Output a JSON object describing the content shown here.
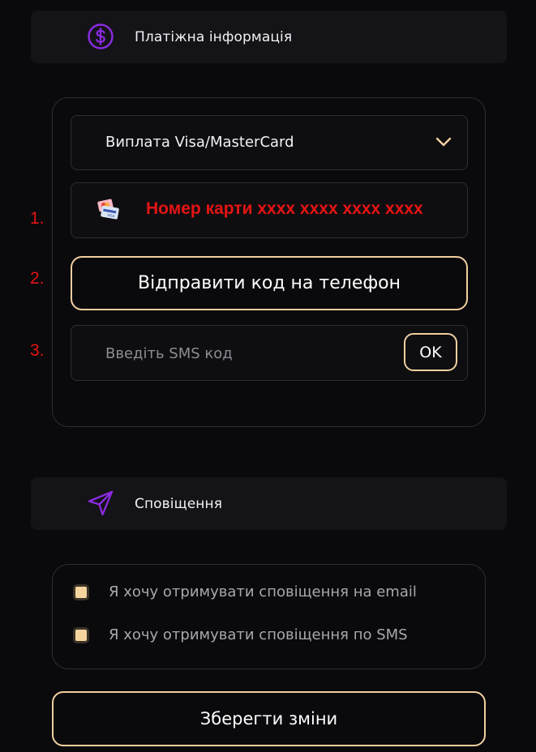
{
  "payment_section": {
    "title": "Платіжна інформація",
    "icon": "dollar-icon"
  },
  "payment": {
    "method_selected": "Виплата Visa/MasterCard",
    "card_number_text": "Номер карти xxxx xxxx xxxx xxxx",
    "send_code_label": "Відправити код на телефон",
    "sms_placeholder": "Введіть SMS код",
    "ok_label": "OK"
  },
  "steps": [
    "1.",
    "2.",
    "3."
  ],
  "notifications_section": {
    "title": "Сповіщення",
    "icon": "send-icon"
  },
  "notifications": {
    "email_label": "Я хочу отримувати сповіщення на email",
    "email_checked": true,
    "sms_label": "Я хочу отримувати сповіщення по SMS",
    "sms_checked": true
  },
  "save_label": "Зберегти зміни",
  "colors": {
    "background": "#0a090c",
    "accent": "#f2cfa0",
    "icon_purple": "#8a2be2",
    "annotation_red": "#e51414"
  }
}
